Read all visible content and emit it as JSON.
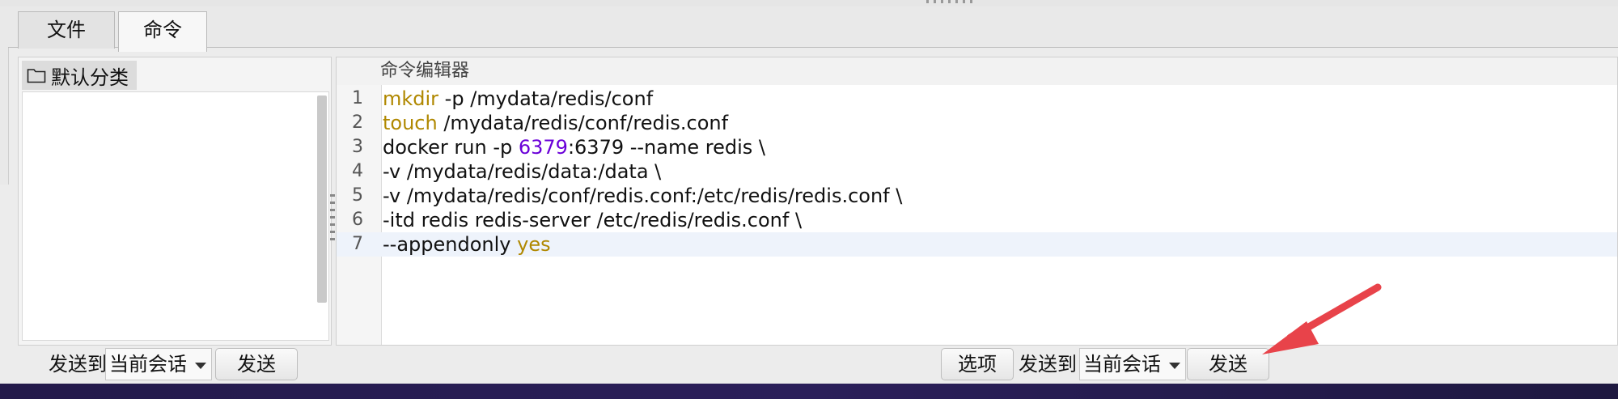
{
  "tabs": [
    {
      "label": "文件"
    },
    {
      "label": "命令"
    }
  ],
  "categories": {
    "header_label": "默认分类",
    "header_icon": "folder-icon"
  },
  "editor": {
    "title": "命令编辑器",
    "lines": [
      {
        "num": "1",
        "segments": [
          {
            "text": "mkdir",
            "kind": "kw"
          },
          {
            "text": " -p /mydata/redis/conf",
            "kind": "plain"
          }
        ]
      },
      {
        "num": "2",
        "segments": [
          {
            "text": "touch",
            "kind": "kw"
          },
          {
            "text": " /mydata/redis/conf/redis.conf",
            "kind": "plain"
          }
        ]
      },
      {
        "num": "3",
        "segments": [
          {
            "text": "docker run -p ",
            "kind": "plain"
          },
          {
            "text": "6379",
            "kind": "num"
          },
          {
            "text": ":6379 --name redis \\",
            "kind": "plain"
          }
        ]
      },
      {
        "num": "4",
        "segments": [
          {
            "text": "-v /mydata/redis/data:/data \\",
            "kind": "plain"
          }
        ]
      },
      {
        "num": "5",
        "segments": [
          {
            "text": "-v /mydata/redis/conf/redis.conf:/etc/redis/redis.conf \\",
            "kind": "plain"
          }
        ]
      },
      {
        "num": "6",
        "segments": [
          {
            "text": "-itd redis redis-server /etc/redis/redis.conf \\",
            "kind": "plain"
          }
        ]
      },
      {
        "num": "7",
        "segments": [
          {
            "text": "--appendonly ",
            "kind": "plain"
          },
          {
            "text": "yes",
            "kind": "kw"
          }
        ],
        "active": true
      }
    ]
  },
  "left_send": {
    "send_to_label": "发送到",
    "target_value": "当前会话",
    "send_button": "发送"
  },
  "right_send": {
    "options_button": "选项",
    "send_to_label": "发送到",
    "target_value": "当前会话",
    "send_button": "发送"
  },
  "colors": {
    "keyword": "#b08800",
    "number": "#6a00d8",
    "annotation_arrow": "#e8434a"
  }
}
